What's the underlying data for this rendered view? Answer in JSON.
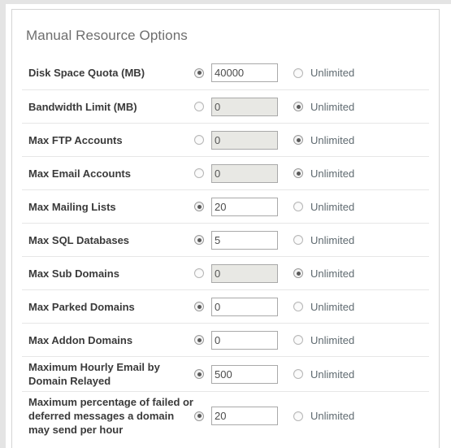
{
  "panel": {
    "title": "Manual Resource Options",
    "unlimited_label": "Unlimited",
    "rows": [
      {
        "label": "Disk Space Quota (MB)",
        "value": "40000",
        "value_selected": true,
        "unlimited_selected": false,
        "input_disabled": false
      },
      {
        "label": "Bandwidth Limit (MB)",
        "value": "0",
        "value_selected": false,
        "unlimited_selected": true,
        "input_disabled": true
      },
      {
        "label": "Max FTP Accounts",
        "value": "0",
        "value_selected": false,
        "unlimited_selected": true,
        "input_disabled": true
      },
      {
        "label": "Max Email Accounts",
        "value": "0",
        "value_selected": false,
        "unlimited_selected": true,
        "input_disabled": true
      },
      {
        "label": "Max Mailing Lists",
        "value": "20",
        "value_selected": true,
        "unlimited_selected": false,
        "input_disabled": false
      },
      {
        "label": "Max SQL Databases",
        "value": "5",
        "value_selected": true,
        "unlimited_selected": false,
        "input_disabled": false
      },
      {
        "label": "Max Sub Domains",
        "value": "0",
        "value_selected": false,
        "unlimited_selected": true,
        "input_disabled": true
      },
      {
        "label": "Max Parked Domains",
        "value": "0",
        "value_selected": true,
        "unlimited_selected": false,
        "input_disabled": false
      },
      {
        "label": "Max Addon Domains",
        "value": "0",
        "value_selected": true,
        "unlimited_selected": false,
        "input_disabled": false
      },
      {
        "label": "Maximum Hourly Email by Domain Relayed",
        "value": "500",
        "value_selected": true,
        "unlimited_selected": false,
        "input_disabled": false
      },
      {
        "label": "Maximum percentage of failed or deferred messages a domain may send per hour",
        "value": "20",
        "value_selected": true,
        "unlimited_selected": false,
        "input_disabled": false
      }
    ]
  }
}
